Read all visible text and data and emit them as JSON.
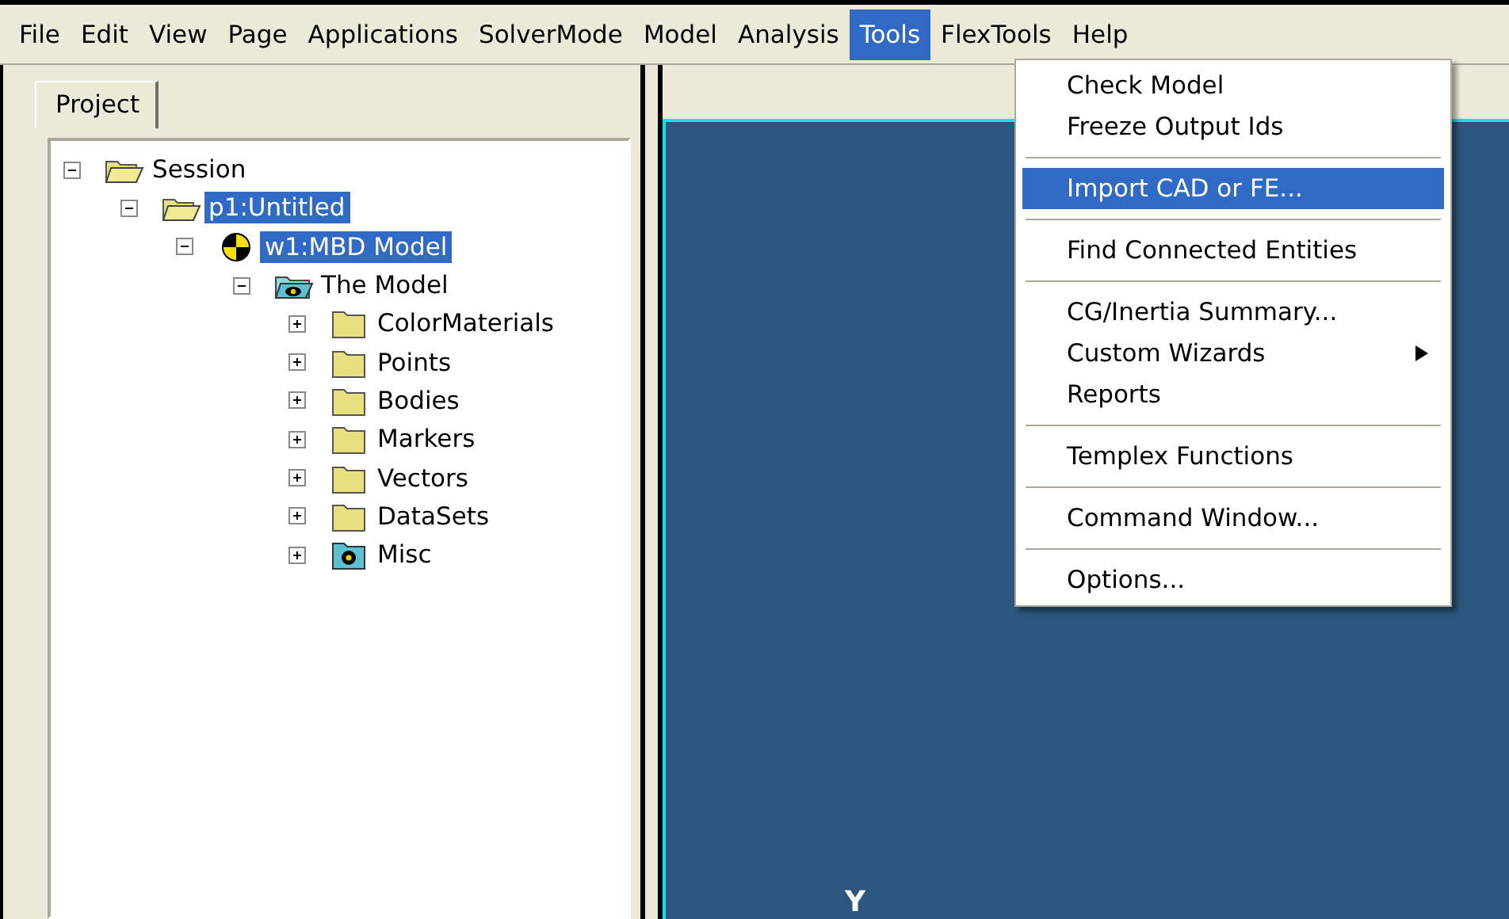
{
  "menubar": [
    {
      "label": "File",
      "selected": false
    },
    {
      "label": "Edit",
      "selected": false
    },
    {
      "label": "View",
      "selected": false
    },
    {
      "label": "Page",
      "selected": false
    },
    {
      "label": "Applications",
      "selected": false
    },
    {
      "label": "SolverMode",
      "selected": false
    },
    {
      "label": "Model",
      "selected": false
    },
    {
      "label": "Analysis",
      "selected": false
    },
    {
      "label": "Tools",
      "selected": true
    },
    {
      "label": "FlexTools",
      "selected": false
    },
    {
      "label": "Help",
      "selected": false
    }
  ],
  "project_panel": {
    "tab": "Project",
    "tree": [
      {
        "label": "Session",
        "kind": "open-folder",
        "expanded": true,
        "selected": false,
        "children": [
          {
            "label": "p1:Untitled",
            "kind": "open-folder",
            "expanded": true,
            "selected": true,
            "children": [
              {
                "label": "w1:MBD Model",
                "kind": "model",
                "expanded": true,
                "selected": true,
                "children": [
                  {
                    "label": "The Model",
                    "kind": "model-folder",
                    "expanded": true,
                    "selected": false,
                    "children": [
                      {
                        "label": "ColorMaterials",
                        "kind": "folder",
                        "expanded": false,
                        "selected": false
                      },
                      {
                        "label": "Points",
                        "kind": "folder",
                        "expanded": false,
                        "selected": false
                      },
                      {
                        "label": "Bodies",
                        "kind": "folder",
                        "expanded": false,
                        "selected": false
                      },
                      {
                        "label": "Markers",
                        "kind": "folder",
                        "expanded": false,
                        "selected": false
                      },
                      {
                        "label": "Vectors",
                        "kind": "folder",
                        "expanded": false,
                        "selected": false
                      },
                      {
                        "label": "DataSets",
                        "kind": "folder",
                        "expanded": false,
                        "selected": false
                      },
                      {
                        "label": "Misc",
                        "kind": "misc-folder",
                        "expanded": false,
                        "selected": false
                      }
                    ]
                  }
                ]
              }
            ]
          }
        ]
      }
    ]
  },
  "viewport": {
    "axis_label": "Y"
  },
  "tools_menu": {
    "sections": [
      [
        {
          "label": "Check Model",
          "selected": false,
          "submenu": false
        },
        {
          "label": "Freeze Output Ids",
          "selected": false,
          "submenu": false
        }
      ],
      [
        {
          "label": "Import CAD or FE...",
          "selected": true,
          "submenu": false
        }
      ],
      [
        {
          "label": "Find Connected Entities",
          "selected": false,
          "submenu": false
        }
      ],
      [
        {
          "label": "CG/Inertia Summary...",
          "selected": false,
          "submenu": false
        },
        {
          "label": "Custom Wizards",
          "selected": false,
          "submenu": true
        },
        {
          "label": "Reports",
          "selected": false,
          "submenu": false
        }
      ],
      [
        {
          "label": "Templex Functions",
          "selected": false,
          "submenu": false
        }
      ],
      [
        {
          "label": "Command Window...",
          "selected": false,
          "submenu": false
        }
      ],
      [
        {
          "label": "Options...",
          "selected": false,
          "submenu": false
        }
      ]
    ]
  }
}
